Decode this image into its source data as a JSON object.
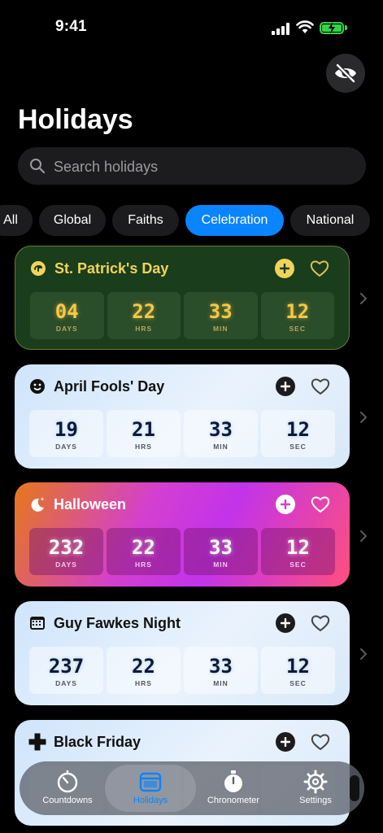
{
  "status": {
    "time": "9:41"
  },
  "header": {
    "title": "Holidays"
  },
  "search": {
    "placeholder": "Search holidays",
    "value": ""
  },
  "filters": {
    "chips": [
      {
        "label": "All"
      },
      {
        "label": "Global"
      },
      {
        "label": "Faiths"
      },
      {
        "label": "Celebration",
        "selected": true
      },
      {
        "label": "National"
      }
    ]
  },
  "holidays": [
    {
      "name": "St. Patrick's Day",
      "icon": "clover-badge-icon",
      "countdown": {
        "days": "04",
        "hrs": "22",
        "min": "33",
        "sec": "12"
      }
    },
    {
      "name": "April Fools' Day",
      "icon": "smiley-icon",
      "countdown": {
        "days": "19",
        "hrs": "21",
        "min": "33",
        "sec": "12"
      }
    },
    {
      "name": "Halloween",
      "icon": "moon-stars-icon",
      "countdown": {
        "days": "232",
        "hrs": "22",
        "min": "33",
        "sec": "12"
      }
    },
    {
      "name": "Guy Fawkes Night",
      "icon": "calendar-icon",
      "countdown": {
        "days": "237",
        "hrs": "22",
        "min": "33",
        "sec": "12"
      }
    },
    {
      "name": "Black Friday",
      "icon": "cross-icon"
    }
  ],
  "units": {
    "days": "DAYS",
    "hrs": "HRS",
    "min": "MIN",
    "sec": "SEC"
  },
  "tabbar": {
    "tabs": [
      {
        "label": "Countdowns",
        "icon": "timer-icon"
      },
      {
        "label": "Holidays",
        "icon": "calendar-icon",
        "selected": true
      },
      {
        "label": "Chronometer",
        "icon": "stopwatch-icon"
      },
      {
        "label": "Settings",
        "icon": "gear-icon"
      }
    ]
  },
  "colors": {
    "accent": "#0a84ff",
    "stpatrick_gold": "#f5c845",
    "halloween_pink": "#d43fd0"
  }
}
